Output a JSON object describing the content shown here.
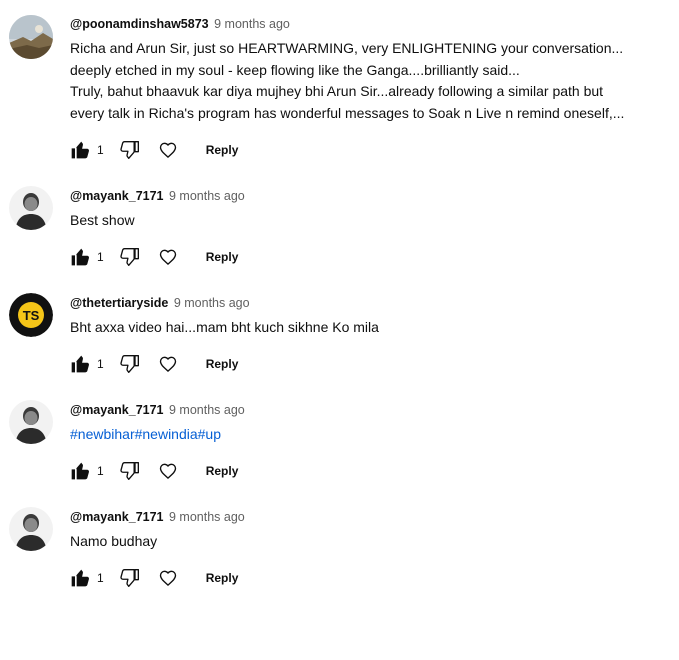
{
  "comments": [
    {
      "author": "@poonamdinshaw5873",
      "time": "9 months ago",
      "lines": [
        "Richa and Arun Sir, just so HEARTWARMING, very ENLIGHTENING  your conversation...",
        "deeply etched in my soul - keep flowing like the Ganga....brilliantly said...",
        "Truly, bahut bhaavuk kar diya mujhey bhi Arun Sir...already following a similar path but",
        "every talk in Richa's program has wonderful messages to Soak n Live n remind oneself,..."
      ],
      "likes": "1",
      "reply_label": "Reply",
      "avatar": "landscape-photo"
    },
    {
      "author": "@mayank_7171",
      "time": "9 months ago",
      "lines": [
        "Best show"
      ],
      "likes": "1",
      "reply_label": "Reply",
      "avatar": "person-photo-grayscale"
    },
    {
      "author": "@thetertiaryside",
      "time": "9 months ago",
      "lines": [
        "Bht axxa video hai...mam bht kuch sikhne Ko mila"
      ],
      "likes": "1",
      "reply_label": "Reply",
      "avatar": "ts-logo",
      "avatar_text": "TS"
    },
    {
      "author": "@mayank_7171",
      "time": "9 months ago",
      "lines": [
        "#newbihar#newindia#up"
      ],
      "likes": "1",
      "reply_label": "Reply",
      "avatar": "person-photo-grayscale"
    },
    {
      "author": "@mayank_7171",
      "time": "9 months ago",
      "lines": [
        "Namo budhay"
      ],
      "likes": "1",
      "reply_label": "Reply",
      "avatar": "person-photo-grayscale"
    }
  ],
  "colors": {
    "hashtag": "#065fd4",
    "ts_logo_bg": "#111111",
    "ts_logo_fg": "#f5c518"
  },
  "icons": [
    "thumbs-up-icon",
    "thumbs-down-icon",
    "heart-icon"
  ]
}
